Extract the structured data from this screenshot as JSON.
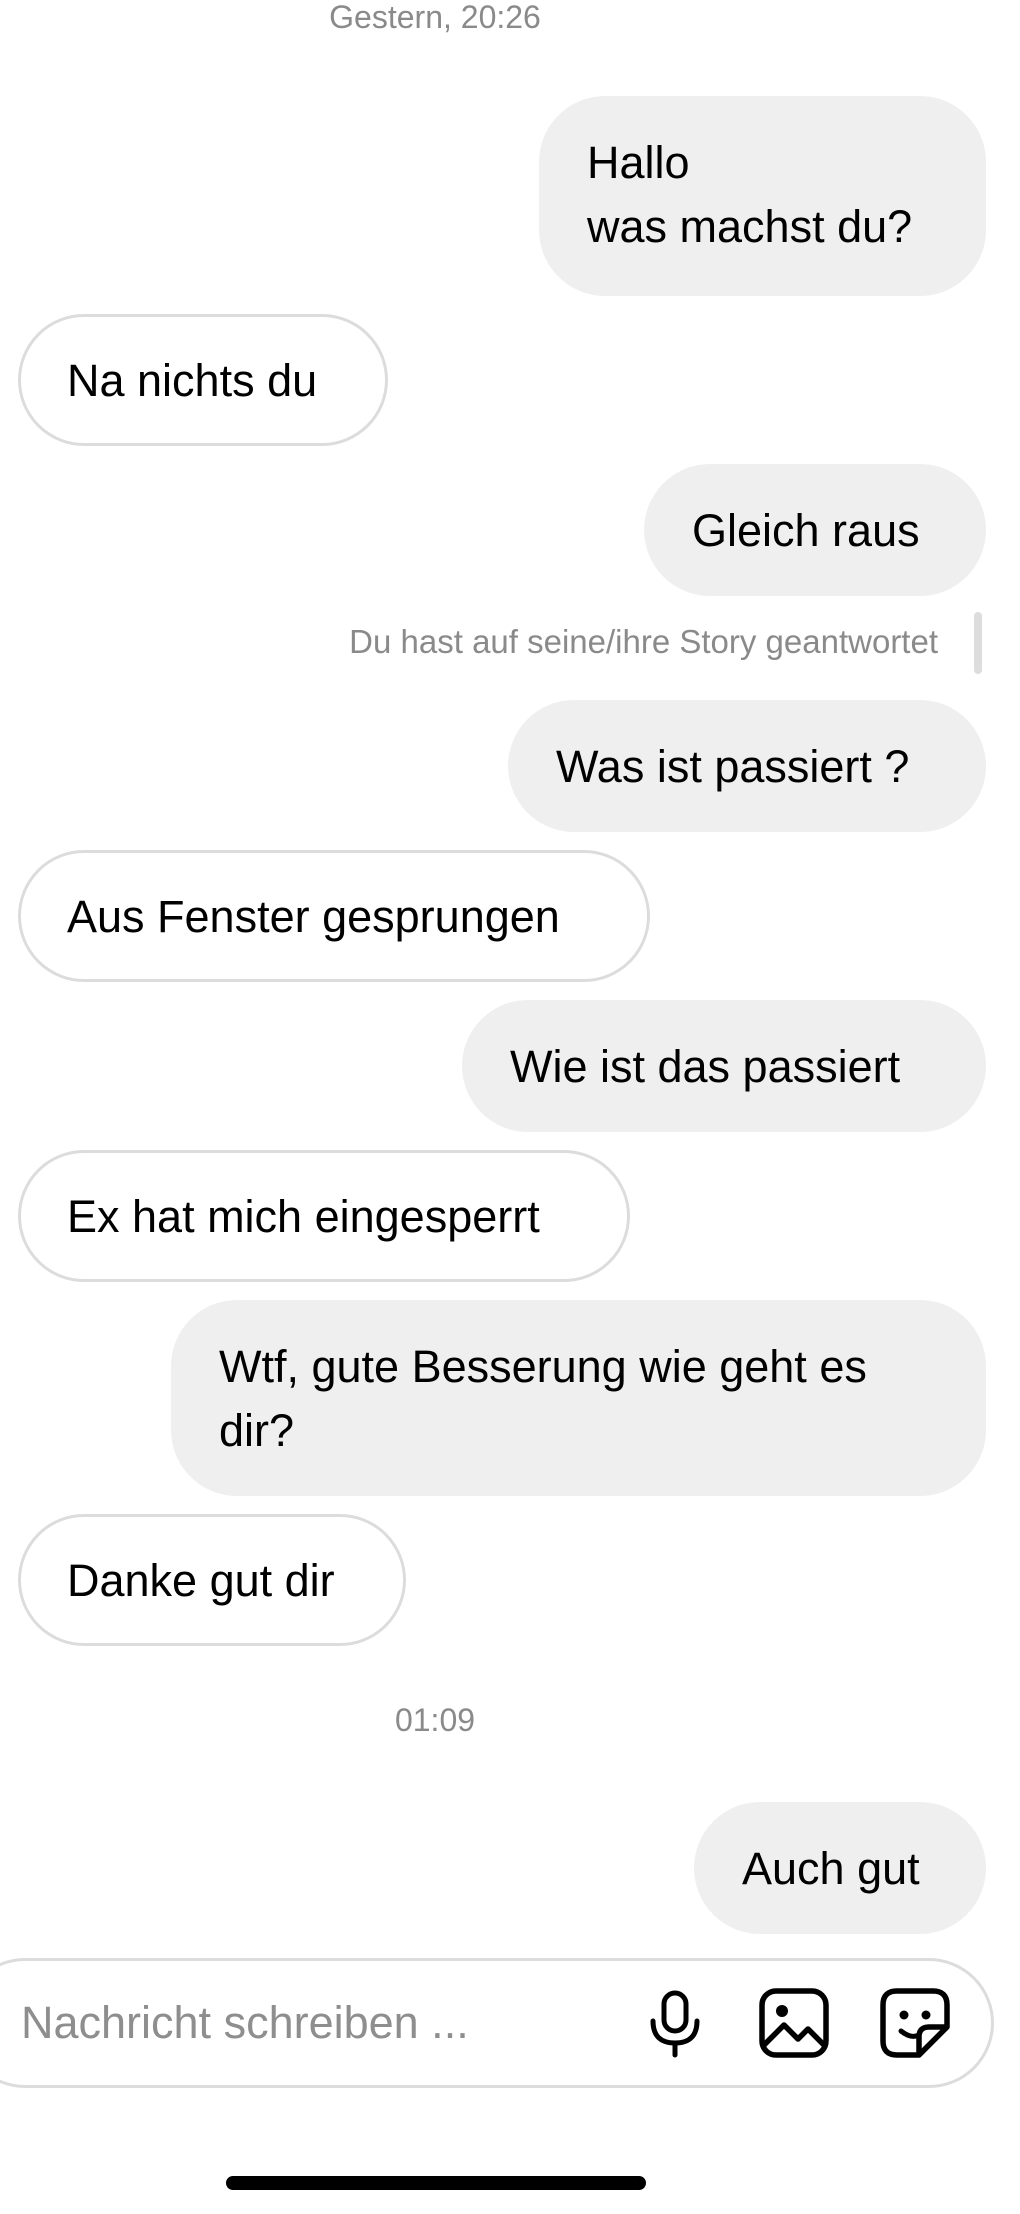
{
  "timestamps": {
    "first": "Gestern, 20:26",
    "second": "01:09"
  },
  "messages": [
    {
      "direction": "sent",
      "text": "Hallo\nwas machst du?"
    },
    {
      "direction": "received",
      "text": "Na nichts du"
    },
    {
      "direction": "sent",
      "text": "Gleich raus"
    },
    {
      "direction": "sent",
      "text": "Was ist passiert ?"
    },
    {
      "direction": "received",
      "text": "Aus Fenster gesprungen"
    },
    {
      "direction": "sent",
      "text": "Wie ist das passiert"
    },
    {
      "direction": "received",
      "text": "Ex hat mich eingesperrt"
    },
    {
      "direction": "sent",
      "text": "Wtf, gute Besserung wie geht es\ndir?"
    },
    {
      "direction": "received",
      "text": "Danke gut dir"
    },
    {
      "direction": "sent",
      "text": "Auch gut"
    }
  ],
  "story_reply_note": "Du hast auf seine/ihre Story geantwortet",
  "composer": {
    "placeholder": "Nachricht schreiben ...",
    "icons": [
      "microphone-icon",
      "image-icon",
      "sticker-icon"
    ]
  },
  "colors": {
    "sent_bubble": "#efefef",
    "received_border": "#dcdcdc",
    "muted_text": "#8a8a8a"
  }
}
